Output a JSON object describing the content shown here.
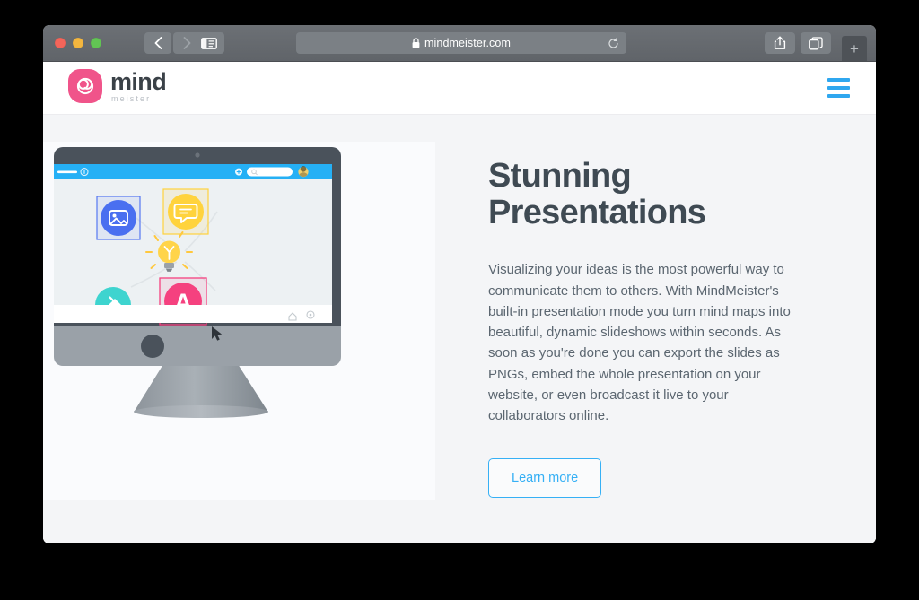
{
  "browser": {
    "url": "mindmeister.com",
    "secure_icon": "lock-icon",
    "back_label": "Back",
    "forward_label": "Forward",
    "sidebar_label": "Show sidebar",
    "share_label": "Share",
    "tabs_label": "Show tab overview",
    "new_tab_label": "+",
    "reload_label": "Reload"
  },
  "site": {
    "brand_name": "mind",
    "brand_sub": "meister",
    "menu_label": "Menu"
  },
  "hero": {
    "title_line1": "Stunning",
    "title_line2": "Presentations",
    "description": "Visualizing your ideas is the most powerful way to communicate them to others. With MindMeister's built-in presentation mode you turn mind maps into beautiful, dynamic slideshows within seconds. As soon as you're done you can export the slides as PNGs, embed the whole presentation on your website, or even broadcast it live to your collaborators online.",
    "cta_label": "Learn more"
  },
  "illustration": {
    "app_node_letter": "A",
    "nodes": [
      {
        "name": "image-node",
        "color": "#4a6ff0",
        "icon": "image-icon"
      },
      {
        "name": "comment-node",
        "color": "#ffd33d",
        "icon": "comment-icon"
      },
      {
        "name": "paint-node",
        "color": "#3ed4cf",
        "icon": "paint-bucket-icon"
      },
      {
        "name": "letter-node",
        "color": "#f5417f",
        "icon": "letter-a-icon"
      }
    ],
    "center_icon": "lightbulb-icon"
  },
  "colors": {
    "brand_pink": "#f0548a",
    "accent_blue": "#2fa7ef",
    "cta_blue": "#36b0f5",
    "heading": "#3f4a53",
    "body_text": "#5b6670"
  }
}
